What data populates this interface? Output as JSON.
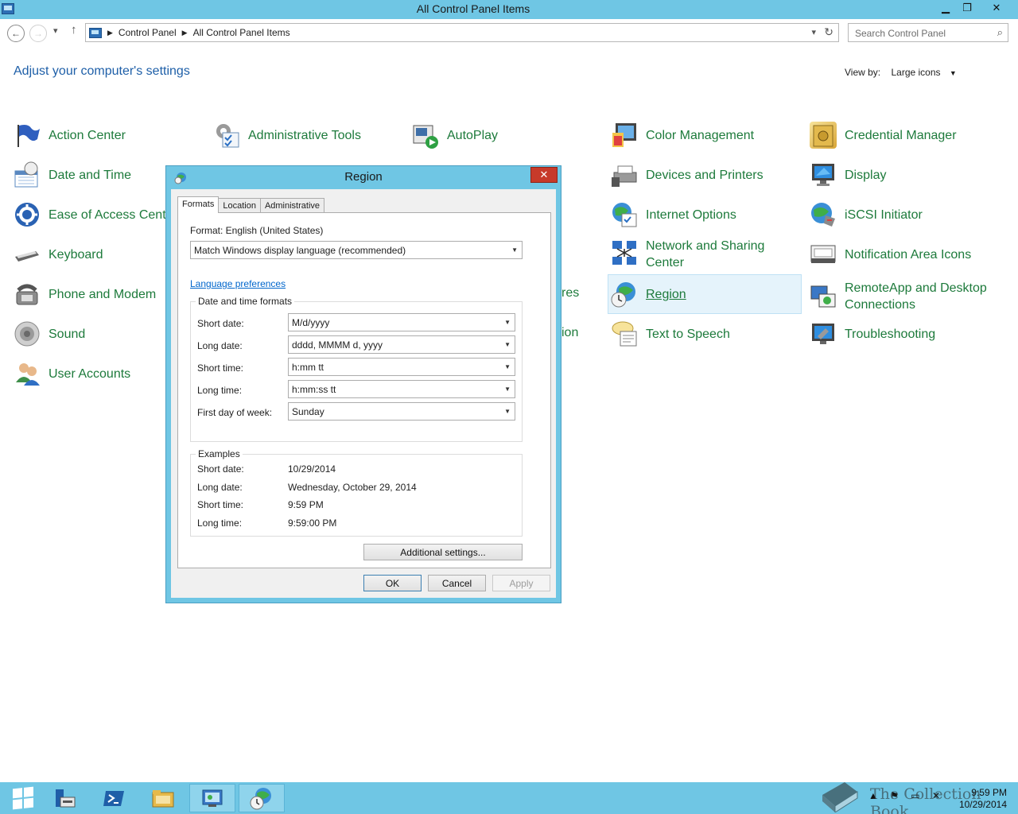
{
  "window": {
    "title": "All Control Panel Items",
    "minimize": "▁",
    "restore": "❐",
    "close": "✕"
  },
  "address": {
    "crumbs": [
      "Control Panel",
      "All Control Panel Items"
    ],
    "search_placeholder": "Search Control Panel"
  },
  "page": {
    "heading": "Adjust your computer's settings",
    "view_by_label": "View by:",
    "view_by_value": "Large icons"
  },
  "items": [
    {
      "label": "Action Center",
      "icon": "flag-icon"
    },
    {
      "label": "Administrative Tools",
      "icon": "tools-icon"
    },
    {
      "label": "AutoPlay",
      "icon": "autoplay-icon"
    },
    {
      "label": "Color Management",
      "icon": "color-management-icon"
    },
    {
      "label": "Credential Manager",
      "icon": "credential-vault-icon"
    },
    {
      "label": "Date and Time",
      "icon": "calendar-clock-icon"
    },
    {
      "label": "Devices and Printers",
      "icon": "printer-icon"
    },
    {
      "label": "Display",
      "icon": "monitor-icon"
    },
    {
      "label": "Ease of Access Center",
      "icon": "ease-of-access-icon"
    },
    {
      "label": "Internet Options",
      "icon": "globe-check-icon"
    },
    {
      "label": "iSCSI Initiator",
      "icon": "iscsi-globe-icon"
    },
    {
      "label": "Keyboard",
      "icon": "keyboard-icon"
    },
    {
      "label": "Network and Sharing Center",
      "icon": "network-icon"
    },
    {
      "label": "Notification Area Icons",
      "icon": "notification-area-icon"
    },
    {
      "label": "Phone and Modem",
      "icon": "phone-icon"
    },
    {
      "label": "Region",
      "icon": "region-globe-icon"
    },
    {
      "label": "RemoteApp and Desktop Connections",
      "icon": "remoteapp-icon"
    },
    {
      "label": "Sound",
      "icon": "speaker-icon"
    },
    {
      "label": "Text to Speech",
      "icon": "speech-bubble-icon"
    },
    {
      "label": "Troubleshooting",
      "icon": "troubleshooting-icon"
    },
    {
      "label": "User Accounts",
      "icon": "users-icon"
    }
  ],
  "hidden_fragments": [
    "res",
    "ion"
  ],
  "dialog": {
    "title": "Region",
    "close": "✕",
    "tabs": [
      "Formats",
      "Location",
      "Administrative"
    ],
    "format_label": "Format: English (United States)",
    "format_value": "Match Windows display language (recommended)",
    "language_link": "Language preferences",
    "datetime_group": "Date and time formats",
    "fields": [
      {
        "label": "Short date:",
        "value": "M/d/yyyy"
      },
      {
        "label": "Long date:",
        "value": "dddd, MMMM d, yyyy"
      },
      {
        "label": "Short time:",
        "value": "h:mm tt"
      },
      {
        "label": "Long time:",
        "value": "h:mm:ss tt"
      },
      {
        "label": "First day of week:",
        "value": "Sunday"
      }
    ],
    "examples_group": "Examples",
    "examples": [
      {
        "label": "Short date:",
        "value": "10/29/2014"
      },
      {
        "label": "Long date:",
        "value": "Wednesday, October 29, 2014"
      },
      {
        "label": "Short time:",
        "value": "9:59 PM"
      },
      {
        "label": "Long time:",
        "value": "9:59:00 PM"
      }
    ],
    "additional_settings": "Additional settings...",
    "ok": "OK",
    "cancel": "Cancel",
    "apply": "Apply"
  },
  "taskbar": {
    "time": "9:59 PM",
    "date": "10/29/2014",
    "watermark": "The Collection Book"
  },
  "colors": {
    "titlebar": "#6fc6e4",
    "link_green": "#1d7a3b",
    "heading_blue": "#1e5fa8"
  }
}
